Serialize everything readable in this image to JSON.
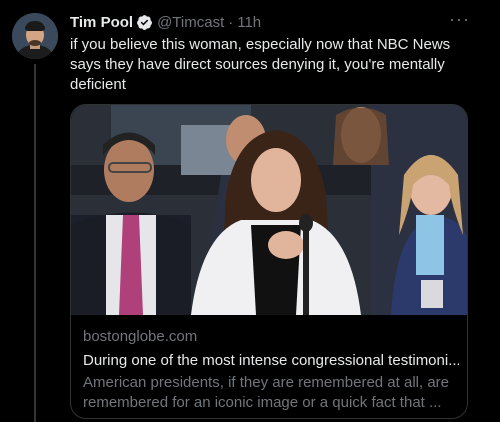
{
  "tweet": {
    "author_name": "Tim Pool",
    "handle": "@Timcast",
    "separator": "·",
    "time": "11h",
    "more": "···",
    "text": "if you believe this woman, especially now that NBC News says they have direct sources denying it, you're mentally deficient"
  },
  "card": {
    "domain": "bostonglobe.com",
    "headline": "During one of the most intense congressional testimoni...",
    "description": "American presidents, if they are remembered at all, are remembered for an iconic image or a quick fact that ..."
  },
  "colors": {
    "background": "#000000",
    "primary_text": "#e7e9ea",
    "secondary_text": "#71767b",
    "verified_blue": "#1d9bf0",
    "border": "#2f3336"
  },
  "icons": {
    "verified": "verified-badge-icon",
    "more": "more-options-icon"
  }
}
